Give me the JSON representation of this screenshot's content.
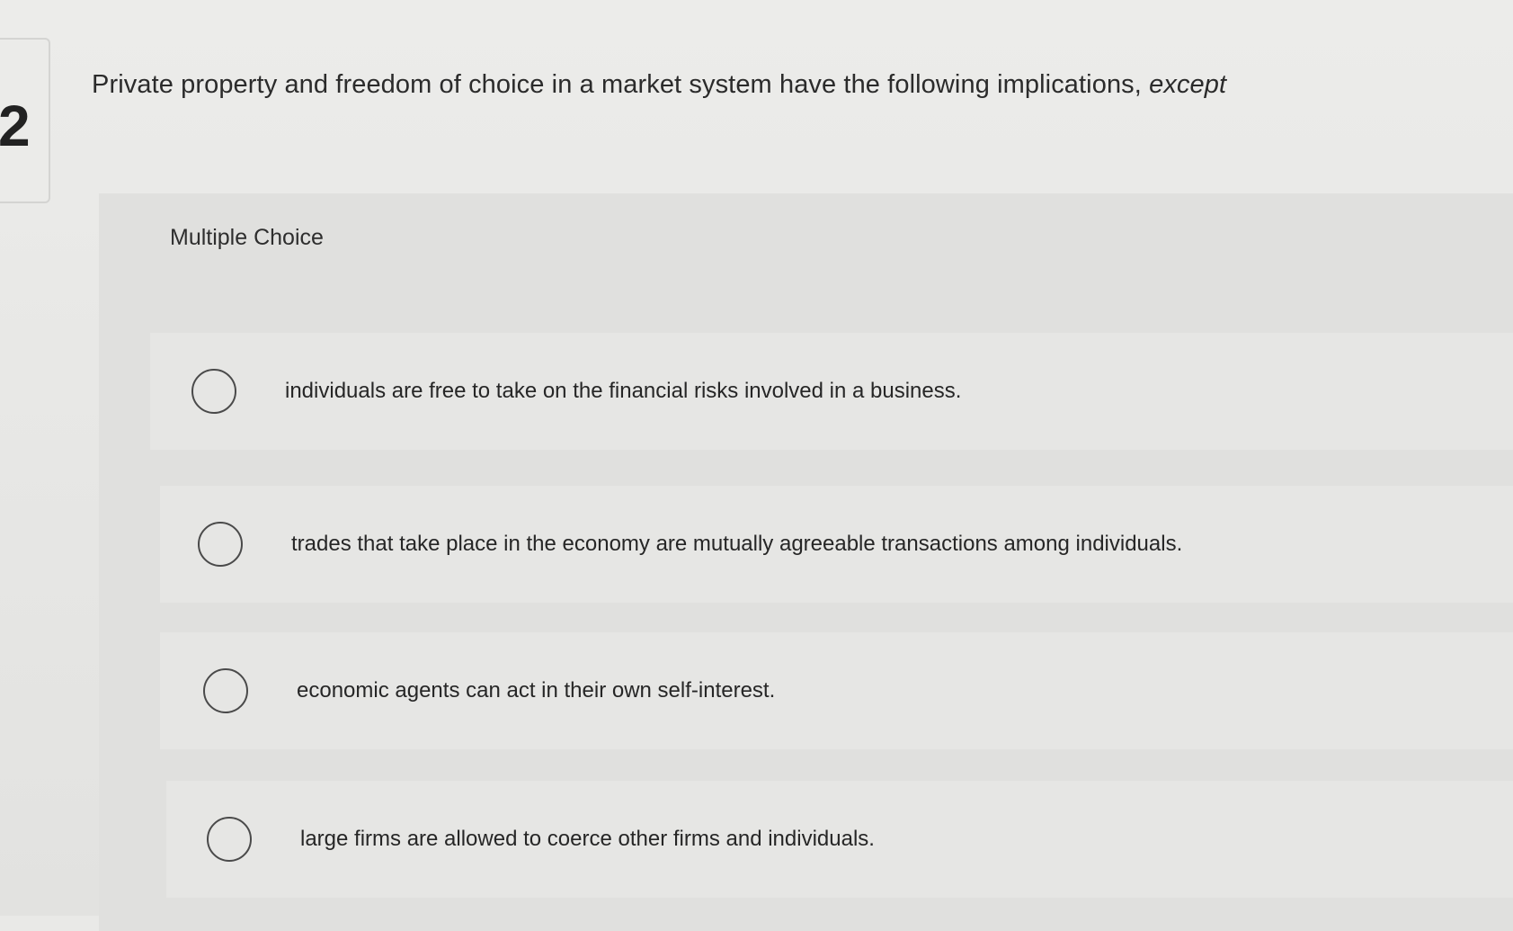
{
  "question": {
    "number": "2",
    "text": "Private property and freedom of choice in a market system have the following implications,",
    "emphasis": "except"
  },
  "choices": {
    "label": "Multiple Choice",
    "options": [
      {
        "text": "individuals are free to take on the financial risks involved in a business."
      },
      {
        "text": "trades that take place in the economy are mutually agreeable transactions among individuals."
      },
      {
        "text": "economic agents can act in their own self-interest."
      },
      {
        "text": "large firms are allowed to coerce other firms and individuals."
      }
    ]
  }
}
